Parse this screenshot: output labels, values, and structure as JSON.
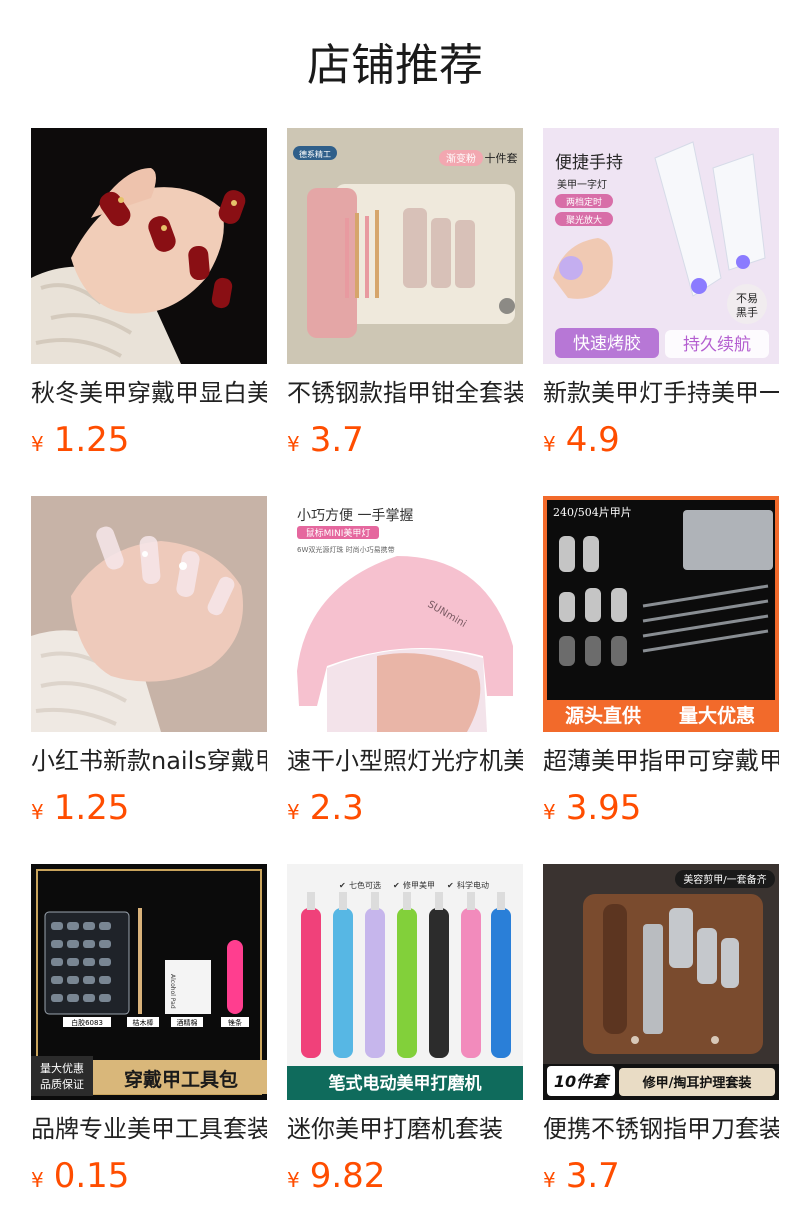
{
  "header": {
    "title": "店铺推荐"
  },
  "currency": "¥",
  "accent_color": "#ff4d00",
  "products": [
    {
      "name": "秋冬美甲穿戴甲显白美甲片",
      "price": "1.25",
      "image_text": []
    },
    {
      "name": "不锈钢款指甲钳全套装",
      "price": "3.7",
      "image_text": [
        "德系精工",
        "渐变粉",
        "十件套"
      ]
    },
    {
      "name": "新款美甲灯手持美甲一字灯",
      "price": "4.9",
      "image_text": [
        "便捷手持",
        "美甲一字灯",
        "两档定时",
        "聚光放大",
        "不易",
        "黑手",
        "快速烤胶",
        "持久续航"
      ]
    },
    {
      "name": "小红书新款nails穿戴甲",
      "price": "1.25",
      "image_text": []
    },
    {
      "name": "速干小型照灯光疗机美甲灯",
      "price": "2.3",
      "image_text": [
        "小巧方便 一手掌握",
        "鼠标MINI美甲灯",
        "6W双光源灯珠 时尚小巧易携带",
        "SUNmini"
      ]
    },
    {
      "name": "超薄美甲指甲可穿戴甲片",
      "price": "3.95",
      "image_text": [
        "240/504片甲片",
        "源头直供",
        "量大优惠"
      ]
    },
    {
      "name": "品牌专业美甲工具套装",
      "price": "0.15",
      "image_text": [
        "白胶6083",
        "桔木棒",
        "酒精棉",
        "锉条",
        "Alcohol Pad",
        "量大优惠",
        "品质保证",
        "穿戴甲工具包"
      ]
    },
    {
      "name": "迷你美甲打磨机套装",
      "price": "9.82",
      "image_text": [
        "七色可选",
        "修甲美甲",
        "科学电动",
        "笔式电动美甲打磨机"
      ]
    },
    {
      "name": "便携不锈钢指甲刀套装",
      "price": "3.7",
      "image_text": [
        "美容剪甲/一套备齐",
        "10件套",
        "修甲/掏耳护理套装"
      ]
    }
  ]
}
